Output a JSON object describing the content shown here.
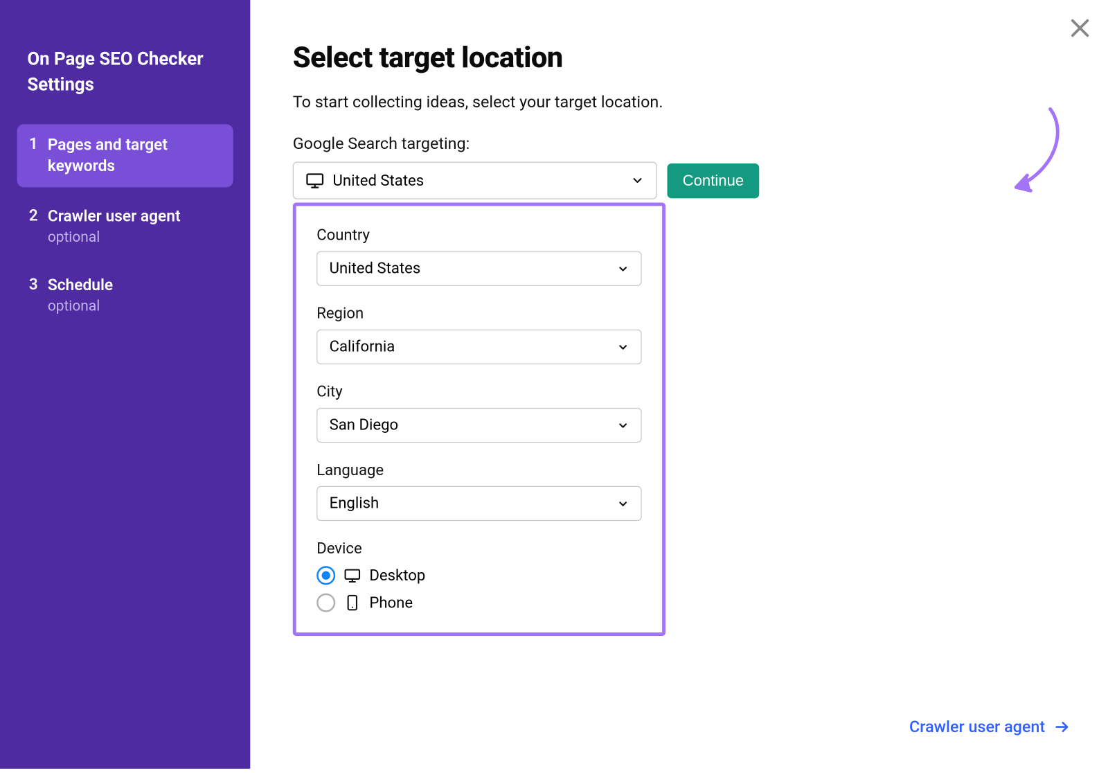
{
  "sidebar": {
    "title": "On Page SEO Checker Settings",
    "items": [
      {
        "num": "1",
        "label": "Pages and target keywords",
        "sublabel": "",
        "active": true
      },
      {
        "num": "2",
        "label": "Crawler user agent",
        "sublabel": "optional",
        "active": false
      },
      {
        "num": "3",
        "label": "Schedule",
        "sublabel": "optional",
        "active": false
      }
    ]
  },
  "page": {
    "title": "Select target location",
    "subtitle": "To start collecting ideas, select your target location.",
    "targeting_label": "Google Search targeting:",
    "main_select_value": "United States",
    "continue_label": "Continue"
  },
  "panel": {
    "country_label": "Country",
    "country_value": "United States",
    "region_label": "Region",
    "region_value": "California",
    "city_label": "City",
    "city_value": "San Diego",
    "language_label": "Language",
    "language_value": "English",
    "device_label": "Device",
    "device_options": {
      "desktop": "Desktop",
      "phone": "Phone"
    },
    "device_selected": "desktop"
  },
  "footer": {
    "next_link": "Crawler user agent"
  }
}
